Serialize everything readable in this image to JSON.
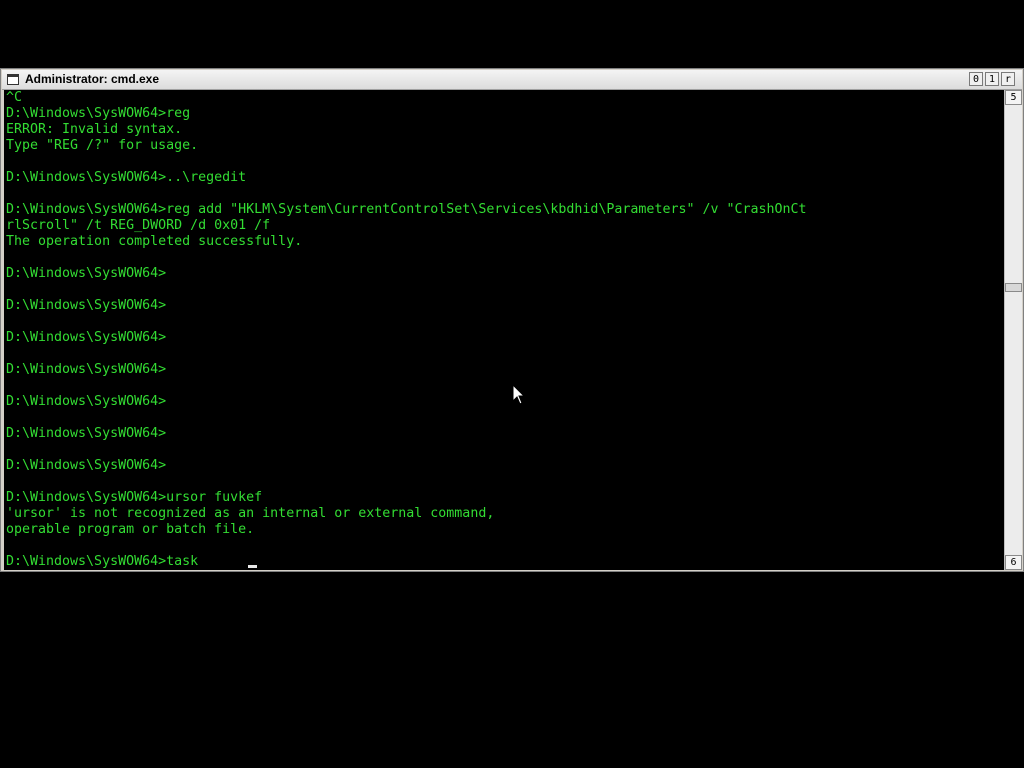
{
  "window": {
    "title": "Administrator: cmd.exe",
    "controls": {
      "minimize": "0",
      "maximize": "1",
      "close": "r"
    }
  },
  "scrollbar": {
    "up": "5",
    "down": "6"
  },
  "console": {
    "lines": [
      "^C",
      "D:\\Windows\\SysWOW64>reg",
      "ERROR: Invalid syntax.",
      "Type \"REG /?\" for usage.",
      "",
      "D:\\Windows\\SysWOW64>..\\regedit",
      "",
      "D:\\Windows\\SysWOW64>reg add \"HKLM\\System\\CurrentControlSet\\Services\\kbdhid\\Parameters\" /v \"CrashOnCt",
      "rlScroll\" /t REG_DWORD /d 0x01 /f",
      "The operation completed successfully.",
      "",
      "D:\\Windows\\SysWOW64>",
      "",
      "D:\\Windows\\SysWOW64>",
      "",
      "D:\\Windows\\SysWOW64>",
      "",
      "D:\\Windows\\SysWOW64>",
      "",
      "D:\\Windows\\SysWOW64>",
      "",
      "D:\\Windows\\SysWOW64>",
      "",
      "D:\\Windows\\SysWOW64>",
      "",
      "D:\\Windows\\SysWOW64>ursor fuvkef",
      "'ursor' is not recognized as an internal or external command,",
      "operable program or batch file.",
      "",
      "D:\\Windows\\SysWOW64>task"
    ]
  },
  "colors": {
    "console_text": "#33dd33",
    "console_background": "#000000",
    "desktop_background": "#000000"
  }
}
